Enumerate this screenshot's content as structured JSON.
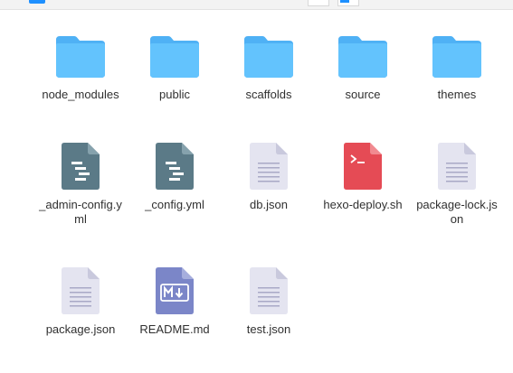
{
  "colors": {
    "folder": "#63c3fd",
    "folder_tab": "#4fb1f5",
    "yml": "#5b7a87",
    "doc": "#e4e4f0",
    "doc_fold": "#c9c9dd",
    "shell": "#e54b55",
    "markdown": "#7b86c8"
  },
  "items": [
    {
      "name": "node_modules",
      "icon": "folder-icon"
    },
    {
      "name": "public",
      "icon": "folder-icon"
    },
    {
      "name": "scaffolds",
      "icon": "folder-icon"
    },
    {
      "name": "source",
      "icon": "folder-icon"
    },
    {
      "name": "themes",
      "icon": "folder-icon"
    },
    {
      "name": "_admin-config.yml",
      "icon": "yml-file-icon"
    },
    {
      "name": "_config.yml",
      "icon": "yml-file-icon"
    },
    {
      "name": "db.json",
      "icon": "text-file-icon"
    },
    {
      "name": "hexo-deploy.sh",
      "icon": "shell-script-icon"
    },
    {
      "name": "package-lock.json",
      "icon": "text-file-icon"
    },
    {
      "name": "package.json",
      "icon": "text-file-icon"
    },
    {
      "name": "README.md",
      "icon": "markdown-file-icon"
    },
    {
      "name": "test.json",
      "icon": "text-file-icon"
    }
  ]
}
